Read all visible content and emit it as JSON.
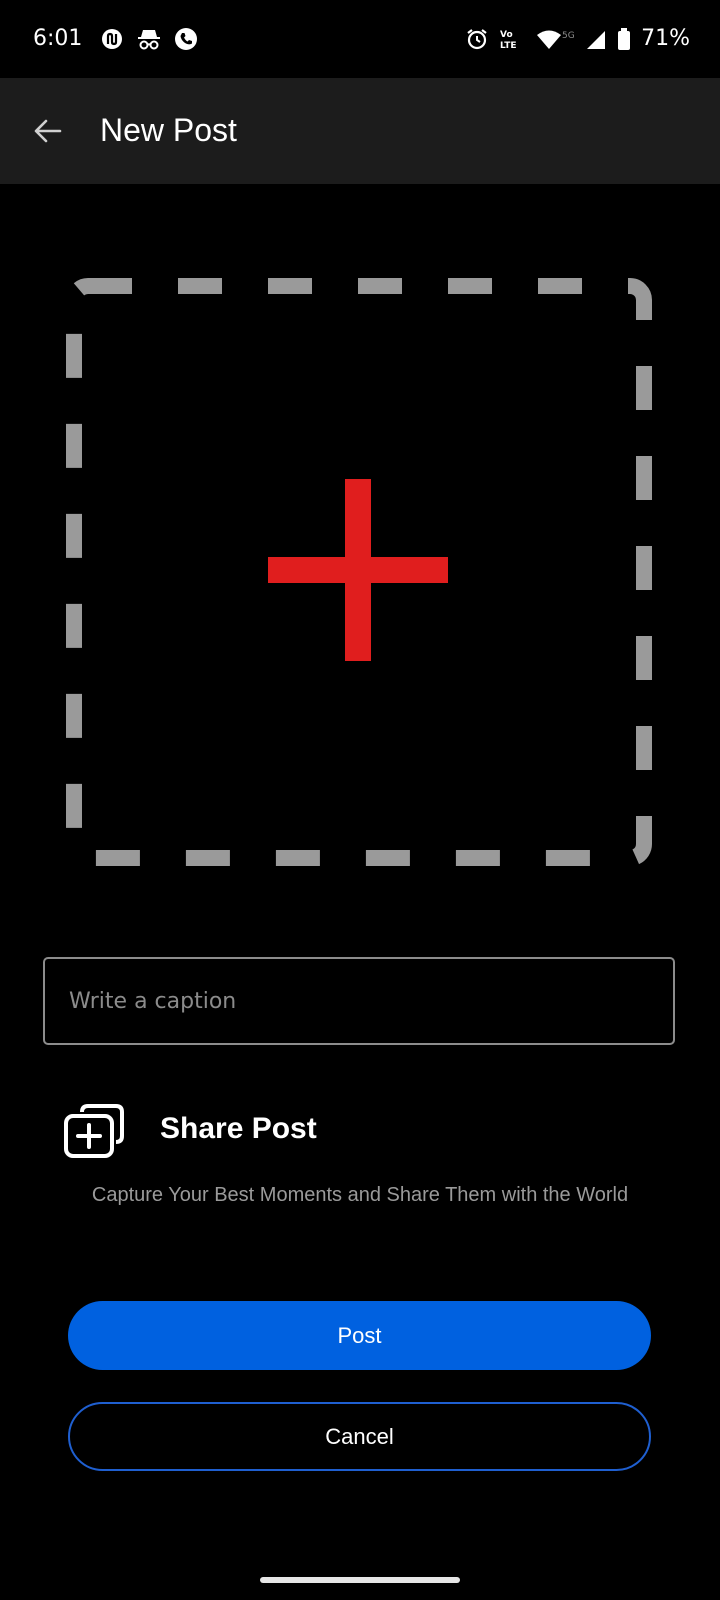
{
  "status_bar": {
    "time": "6:01",
    "battery": "71%",
    "left_icons": [
      "app-notification-icon",
      "incognito-icon",
      "phone-app-icon"
    ],
    "right_icons": [
      "alarm-icon",
      "volte-icon",
      "wifi-icon",
      "cellular-signal-icon",
      "battery-icon"
    ],
    "network_label": "5G"
  },
  "app_bar": {
    "title": "New Post",
    "back_icon": "arrow-left-icon"
  },
  "upload": {
    "icon": "plus-icon",
    "accent_color": "#e01e1e",
    "border_color": "#9a9a9a"
  },
  "caption": {
    "placeholder": "Write a caption",
    "value": ""
  },
  "share": {
    "icon": "add-to-gallery-icon",
    "title": "Share Post",
    "subtitle": "Capture Your Best Moments and Share Them with the World"
  },
  "actions": {
    "post_label": "Post",
    "cancel_label": "Cancel",
    "primary_color": "#0061e0"
  }
}
